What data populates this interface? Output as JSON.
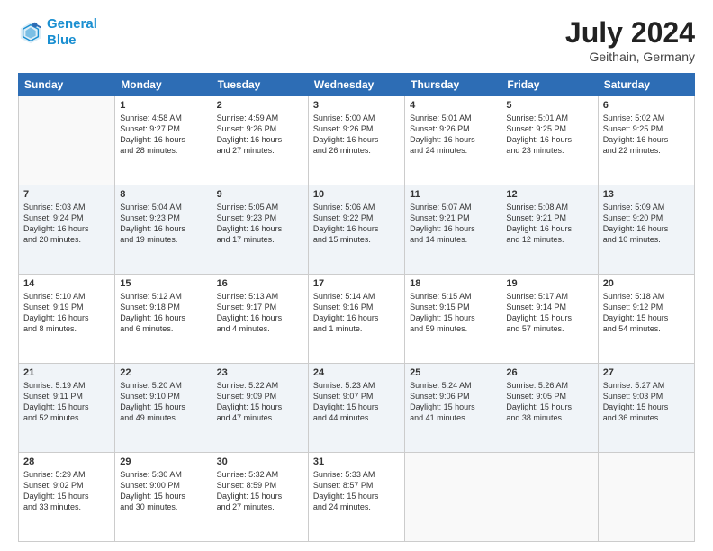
{
  "header": {
    "logo_line1": "General",
    "logo_line2": "Blue",
    "title": "July 2024",
    "subtitle": "Geithain, Germany"
  },
  "weekdays": [
    "Sunday",
    "Monday",
    "Tuesday",
    "Wednesday",
    "Thursday",
    "Friday",
    "Saturday"
  ],
  "weeks": [
    [
      {
        "num": "",
        "info": ""
      },
      {
        "num": "1",
        "info": "Sunrise: 4:58 AM\nSunset: 9:27 PM\nDaylight: 16 hours\nand 28 minutes."
      },
      {
        "num": "2",
        "info": "Sunrise: 4:59 AM\nSunset: 9:26 PM\nDaylight: 16 hours\nand 27 minutes."
      },
      {
        "num": "3",
        "info": "Sunrise: 5:00 AM\nSunset: 9:26 PM\nDaylight: 16 hours\nand 26 minutes."
      },
      {
        "num": "4",
        "info": "Sunrise: 5:01 AM\nSunset: 9:26 PM\nDaylight: 16 hours\nand 24 minutes."
      },
      {
        "num": "5",
        "info": "Sunrise: 5:01 AM\nSunset: 9:25 PM\nDaylight: 16 hours\nand 23 minutes."
      },
      {
        "num": "6",
        "info": "Sunrise: 5:02 AM\nSunset: 9:25 PM\nDaylight: 16 hours\nand 22 minutes."
      }
    ],
    [
      {
        "num": "7",
        "info": "Sunrise: 5:03 AM\nSunset: 9:24 PM\nDaylight: 16 hours\nand 20 minutes."
      },
      {
        "num": "8",
        "info": "Sunrise: 5:04 AM\nSunset: 9:23 PM\nDaylight: 16 hours\nand 19 minutes."
      },
      {
        "num": "9",
        "info": "Sunrise: 5:05 AM\nSunset: 9:23 PM\nDaylight: 16 hours\nand 17 minutes."
      },
      {
        "num": "10",
        "info": "Sunrise: 5:06 AM\nSunset: 9:22 PM\nDaylight: 16 hours\nand 15 minutes."
      },
      {
        "num": "11",
        "info": "Sunrise: 5:07 AM\nSunset: 9:21 PM\nDaylight: 16 hours\nand 14 minutes."
      },
      {
        "num": "12",
        "info": "Sunrise: 5:08 AM\nSunset: 9:21 PM\nDaylight: 16 hours\nand 12 minutes."
      },
      {
        "num": "13",
        "info": "Sunrise: 5:09 AM\nSunset: 9:20 PM\nDaylight: 16 hours\nand 10 minutes."
      }
    ],
    [
      {
        "num": "14",
        "info": "Sunrise: 5:10 AM\nSunset: 9:19 PM\nDaylight: 16 hours\nand 8 minutes."
      },
      {
        "num": "15",
        "info": "Sunrise: 5:12 AM\nSunset: 9:18 PM\nDaylight: 16 hours\nand 6 minutes."
      },
      {
        "num": "16",
        "info": "Sunrise: 5:13 AM\nSunset: 9:17 PM\nDaylight: 16 hours\nand 4 minutes."
      },
      {
        "num": "17",
        "info": "Sunrise: 5:14 AM\nSunset: 9:16 PM\nDaylight: 16 hours\nand 1 minute."
      },
      {
        "num": "18",
        "info": "Sunrise: 5:15 AM\nSunset: 9:15 PM\nDaylight: 15 hours\nand 59 minutes."
      },
      {
        "num": "19",
        "info": "Sunrise: 5:17 AM\nSunset: 9:14 PM\nDaylight: 15 hours\nand 57 minutes."
      },
      {
        "num": "20",
        "info": "Sunrise: 5:18 AM\nSunset: 9:12 PM\nDaylight: 15 hours\nand 54 minutes."
      }
    ],
    [
      {
        "num": "21",
        "info": "Sunrise: 5:19 AM\nSunset: 9:11 PM\nDaylight: 15 hours\nand 52 minutes."
      },
      {
        "num": "22",
        "info": "Sunrise: 5:20 AM\nSunset: 9:10 PM\nDaylight: 15 hours\nand 49 minutes."
      },
      {
        "num": "23",
        "info": "Sunrise: 5:22 AM\nSunset: 9:09 PM\nDaylight: 15 hours\nand 47 minutes."
      },
      {
        "num": "24",
        "info": "Sunrise: 5:23 AM\nSunset: 9:07 PM\nDaylight: 15 hours\nand 44 minutes."
      },
      {
        "num": "25",
        "info": "Sunrise: 5:24 AM\nSunset: 9:06 PM\nDaylight: 15 hours\nand 41 minutes."
      },
      {
        "num": "26",
        "info": "Sunrise: 5:26 AM\nSunset: 9:05 PM\nDaylight: 15 hours\nand 38 minutes."
      },
      {
        "num": "27",
        "info": "Sunrise: 5:27 AM\nSunset: 9:03 PM\nDaylight: 15 hours\nand 36 minutes."
      }
    ],
    [
      {
        "num": "28",
        "info": "Sunrise: 5:29 AM\nSunset: 9:02 PM\nDaylight: 15 hours\nand 33 minutes."
      },
      {
        "num": "29",
        "info": "Sunrise: 5:30 AM\nSunset: 9:00 PM\nDaylight: 15 hours\nand 30 minutes."
      },
      {
        "num": "30",
        "info": "Sunrise: 5:32 AM\nSunset: 8:59 PM\nDaylight: 15 hours\nand 27 minutes."
      },
      {
        "num": "31",
        "info": "Sunrise: 5:33 AM\nSunset: 8:57 PM\nDaylight: 15 hours\nand 24 minutes."
      },
      {
        "num": "",
        "info": ""
      },
      {
        "num": "",
        "info": ""
      },
      {
        "num": "",
        "info": ""
      }
    ]
  ]
}
